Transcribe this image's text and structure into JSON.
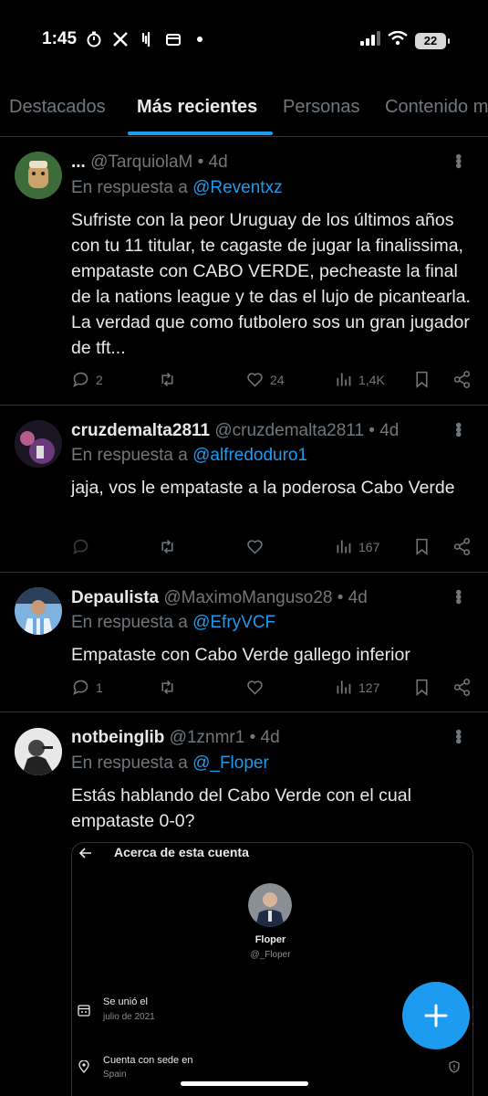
{
  "status_bar": {
    "time": "1:45",
    "left_icons": [
      "timer-icon",
      "x-logo-icon",
      "notification-icon",
      "wallet-icon",
      "dot-icon"
    ],
    "battery": "22"
  },
  "tabs": [
    {
      "label": "Destacados",
      "active": false
    },
    {
      "label": "Más recientes",
      "active": true
    },
    {
      "label": "Personas",
      "active": false
    },
    {
      "label": "Contenido multimedia",
      "active": false
    }
  ],
  "tweets": [
    {
      "name": "...",
      "handle": "@TarquiolaM",
      "time": "• 4d",
      "reply_prefix": "En respuesta a",
      "reply_to": "@Reventxz",
      "text": "Sufriste con la peor Uruguay de los últimos años con tu 11 titular, te cagaste de jugar la finalissima, empataste con CABO VERDE, pecheaste la final de la nations league y te das el lujo de picantearla. La verdad que como futbolero sos un gran jugador de tft...",
      "replies": "2",
      "retweets": "",
      "likes": "24",
      "views": "1,4K"
    },
    {
      "name": "cruzdemalta2811",
      "handle": "@cruzdemalta2811",
      "time": "• 4d",
      "reply_prefix": "En respuesta a",
      "reply_to": "@alfredoduro1",
      "text": "jaja, vos le empataste a la poderosa Cabo Verde",
      "replies": "",
      "retweets": "",
      "likes": "",
      "views": "167"
    },
    {
      "name": "Depaulista",
      "handle": "@MaximoManguso28",
      "time": "• 4d",
      "reply_prefix": "En respuesta a",
      "reply_to": "@EfryVCF",
      "text": "Empataste con Cabo Verde gallego inferior",
      "replies": "1",
      "retweets": "",
      "likes": "",
      "views": "127"
    },
    {
      "name": "notbeinglib",
      "handle": "@1znmr1",
      "time": "• 4d",
      "reply_prefix": "En respuesta a",
      "reply_to": "@_Floper",
      "text": "Estás hablando del Cabo Verde con el cual empataste 0-0?"
    }
  ],
  "embed": {
    "title": "Acerca de esta cuenta",
    "name": "Floper",
    "handle": "@_Floper",
    "joined_label": "Se unió el",
    "joined_value": "julio de 2021",
    "based_label": "Cuenta con sede en",
    "based_value": "Spain"
  },
  "colors": {
    "accent": "#1d9bf0",
    "background": "#000000",
    "muted": "#71767b",
    "text": "#e7e9ea"
  }
}
